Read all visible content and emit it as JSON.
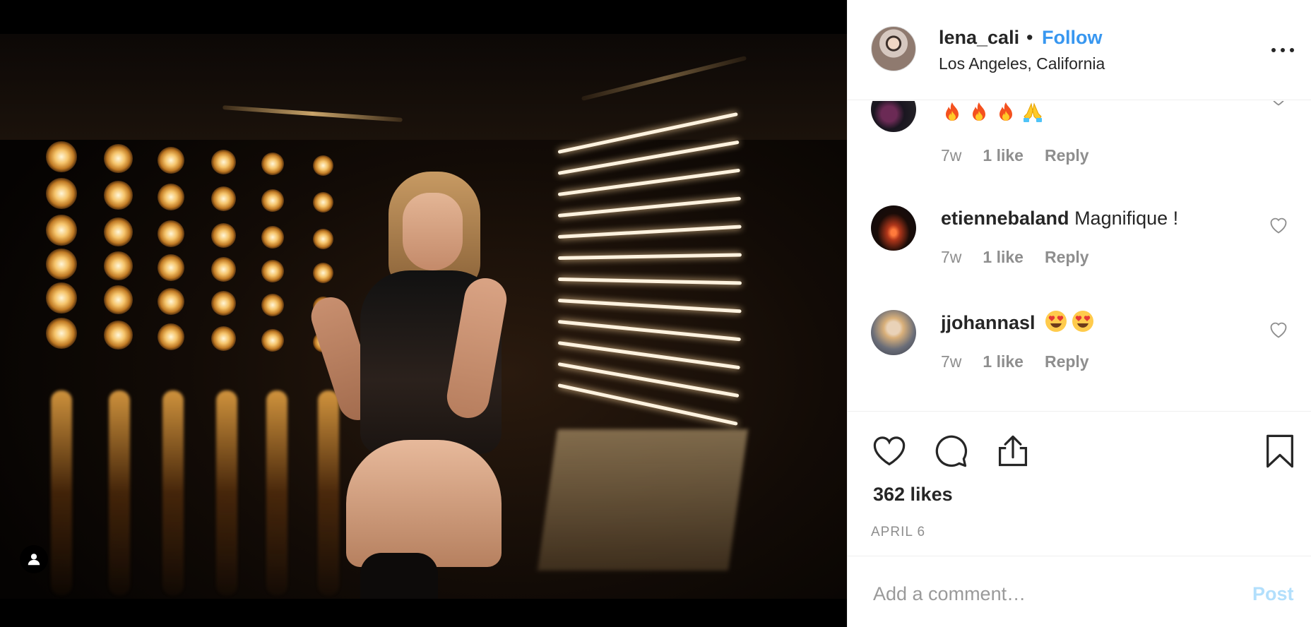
{
  "post": {
    "author": {
      "username": "lena_cali",
      "separator": "•",
      "follow_label": "Follow",
      "location": "Los Angeles, California"
    },
    "media": {
      "alt": "Photo of woman seated in studio with bulbs and light tubes"
    },
    "comments": [
      {
        "username": "",
        "text": "🔥🔥🔥🙏",
        "emojis": [
          "fire",
          "fire",
          "fire",
          "folded-hands"
        ],
        "time": "7w",
        "likes": "1 like",
        "reply": "Reply"
      },
      {
        "username": "etiennebaland",
        "text": "Magnifique !",
        "time": "7w",
        "likes": "1 like",
        "reply": "Reply"
      },
      {
        "username": "jjohannasl",
        "text": "😍😍",
        "emojis": [
          "heart-eyes",
          "heart-eyes"
        ],
        "time": "7w",
        "likes": "1 like",
        "reply": "Reply"
      }
    ],
    "actions": {
      "like_icon": "heart-icon",
      "comment_icon": "comment-icon",
      "share_icon": "share-icon",
      "save_icon": "bookmark-icon"
    },
    "likes_label": "362 likes",
    "date_label": "APRIL 6",
    "add_comment": {
      "placeholder": "Add a comment…",
      "post_label": "Post"
    }
  },
  "colors": {
    "link": "#3897f0",
    "post_disabled": "#b2dffc",
    "muted": "#8e8e8e",
    "text": "#262626"
  }
}
